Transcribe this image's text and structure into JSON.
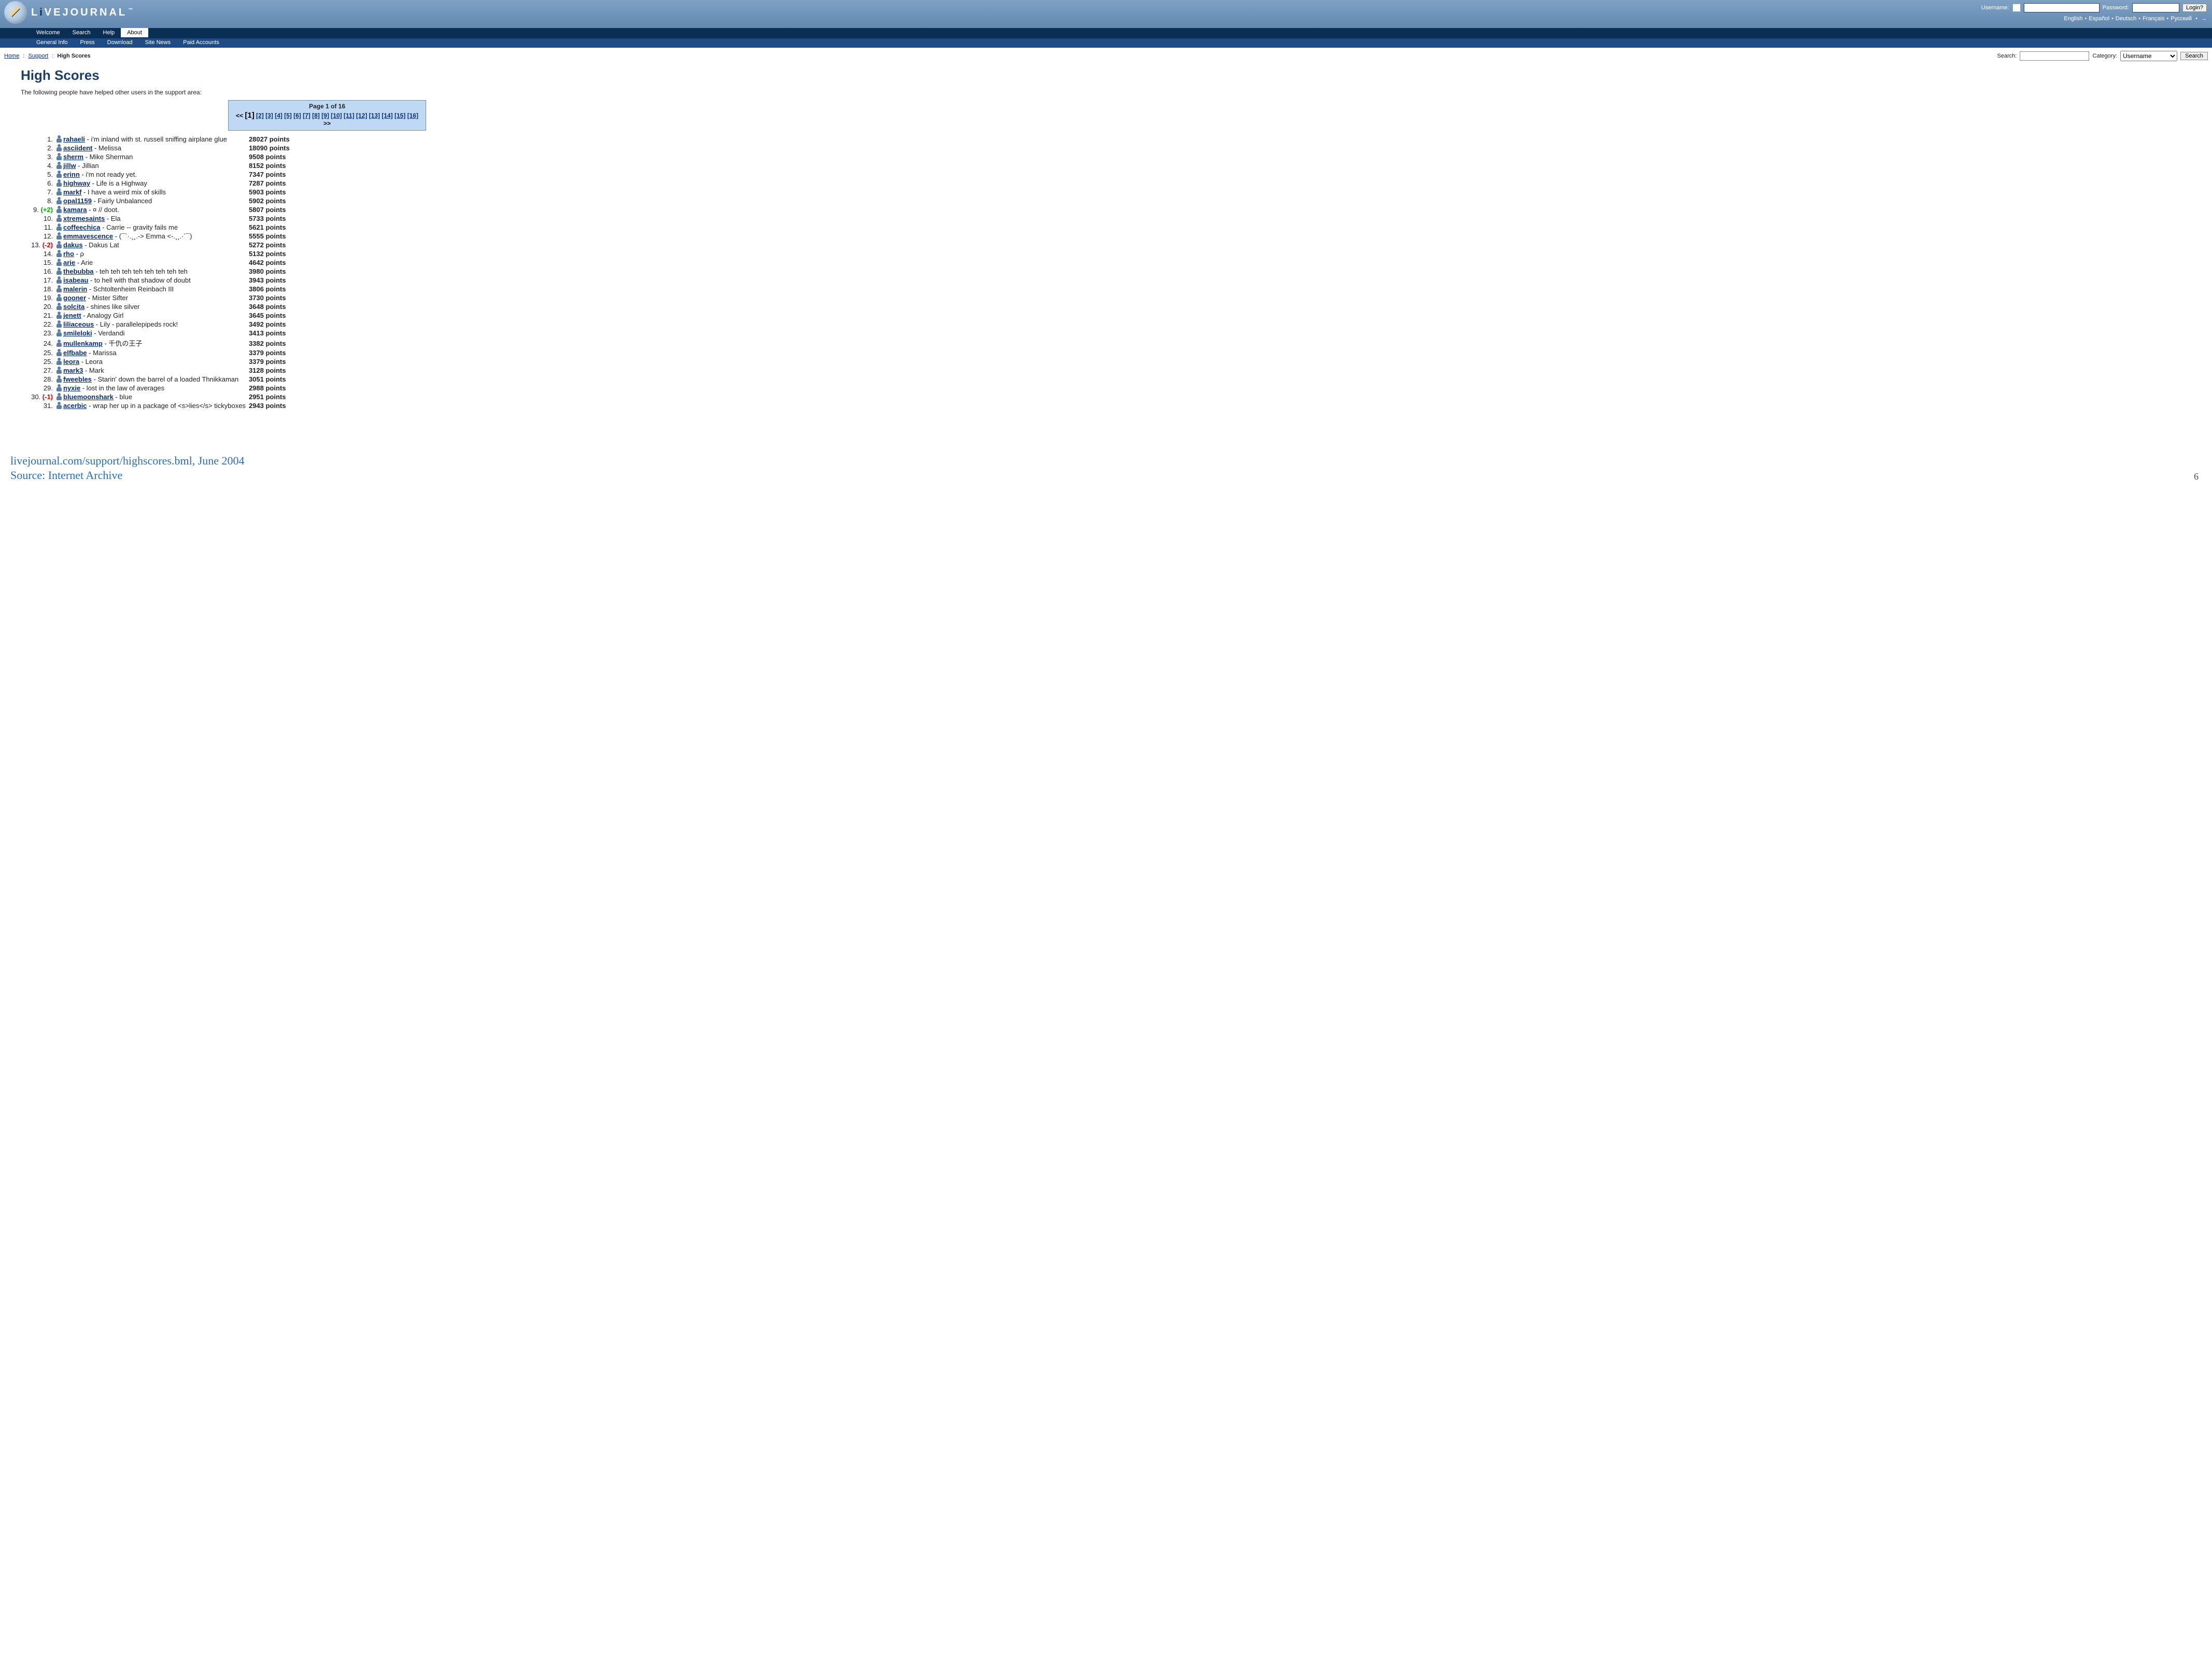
{
  "header": {
    "brand_left": "L",
    "brand_i": "i",
    "brand_rest": "VEJOURNAL",
    "tm": "™",
    "login": {
      "username_label": "Username:",
      "password_label": "Password:",
      "button": "Login?"
    },
    "languages": [
      "English",
      "Español",
      "Deutsch",
      "Français",
      "Русский"
    ],
    "lang_more": "→"
  },
  "nav1": {
    "items": [
      "Welcome",
      "Search",
      "Help",
      "About"
    ],
    "active_index": 3
  },
  "nav2": {
    "items": [
      "General Info",
      "Press",
      "Download",
      "Site News",
      "Paid Accounts"
    ]
  },
  "breadcrumb": {
    "home": "Home",
    "support": "Support",
    "current": "High Scores"
  },
  "search": {
    "label": "Search:",
    "category_label": "Category:",
    "category_value": "Username",
    "button": "Search"
  },
  "page_title": "High Scores",
  "intro": "The following people have helped other users in the support area:",
  "paginator": {
    "page_label": "Page 1 of 16",
    "prev": "<<",
    "next": ">>",
    "current": 1,
    "total": 16
  },
  "rows": [
    {
      "rank": "1.",
      "delta": "",
      "user": "rahaeli",
      "tag": "i'm inland with st. russell sniffing airplane glue",
      "points": "28027 points"
    },
    {
      "rank": "2.",
      "delta": "",
      "user": "asciident",
      "tag": "Melissa",
      "points": "18090 points"
    },
    {
      "rank": "3.",
      "delta": "",
      "user": "sherm",
      "tag": "Mike Sherman",
      "points": "9508 points"
    },
    {
      "rank": "4.",
      "delta": "",
      "user": "jillw",
      "tag": "Jillian",
      "points": "8152 points"
    },
    {
      "rank": "5.",
      "delta": "",
      "user": "erinn",
      "tag": "i'm not ready yet.",
      "points": "7347 points"
    },
    {
      "rank": "6.",
      "delta": "",
      "user": "highway",
      "tag": "Life is a Highway",
      "points": "7287 points"
    },
    {
      "rank": "7.",
      "delta": "",
      "user": "markf",
      "tag": "I have a weird mix of skills",
      "points": "5903 points"
    },
    {
      "rank": "8.",
      "delta": "",
      "user": "opal1159",
      "tag": "Fairly Unbalanced",
      "points": "5902 points"
    },
    {
      "rank": "9.",
      "delta": "(+2)",
      "delta_dir": "up",
      "user": "kamara",
      "tag": "¤ // doot.",
      "points": "5807 points"
    },
    {
      "rank": "10.",
      "delta": "",
      "user": "xtremesaints",
      "tag": "Ela",
      "points": "5733 points"
    },
    {
      "rank": "11.",
      "delta": "",
      "user": "coffeechica",
      "tag": "Carrie -- gravity fails me",
      "points": "5621 points"
    },
    {
      "rank": "12.",
      "delta": "",
      "user": "emmavescence",
      "tag": "(¯`·.¸¸.-> Emma <-.¸¸.·´¯)",
      "points": "5555 points"
    },
    {
      "rank": "13.",
      "delta": "(-2)",
      "delta_dir": "down",
      "user": "dakus",
      "tag": "Dakus Lat",
      "points": "5272 points"
    },
    {
      "rank": "14.",
      "delta": "",
      "user": "rho",
      "tag": "ρ",
      "points": "5132 points"
    },
    {
      "rank": "15.",
      "delta": "",
      "user": "arie",
      "tag": "Arie",
      "points": "4642 points"
    },
    {
      "rank": "16.",
      "delta": "",
      "user": "thebubba",
      "tag": "teh teh teh teh teh teh teh teh",
      "points": "3980 points"
    },
    {
      "rank": "17.",
      "delta": "",
      "user": "isabeau",
      "tag": "to hell with that shadow of doubt",
      "points": "3943 points"
    },
    {
      "rank": "18.",
      "delta": "",
      "user": "malerin",
      "tag": "Schtoltenheim Reinbach III",
      "points": "3806 points"
    },
    {
      "rank": "19.",
      "delta": "",
      "user": "gooner",
      "tag": "Mister Sifter",
      "points": "3730 points"
    },
    {
      "rank": "20.",
      "delta": "",
      "user": "solcita",
      "tag": "shines like silver",
      "points": "3648 points"
    },
    {
      "rank": "21.",
      "delta": "",
      "user": "jenett",
      "tag": "Analogy Girl",
      "points": "3645 points"
    },
    {
      "rank": "22.",
      "delta": "",
      "user": "liliaceous",
      "tag": "Lily - parallelepipeds rock!",
      "points": "3492 points"
    },
    {
      "rank": "23.",
      "delta": "",
      "user": "smileloki",
      "tag": "Verdandi",
      "points": "3413 points"
    },
    {
      "rank": "24.",
      "delta": "",
      "user": "mullenkamp",
      "tag": "千仇の王子",
      "points": "3382 points"
    },
    {
      "rank": "25.",
      "delta": "",
      "user": "elfbabe",
      "tag": "Marissa",
      "points": "3379 points"
    },
    {
      "rank": "25.",
      "delta": "",
      "user": "leora",
      "tag": "Leora",
      "points": "3379 points"
    },
    {
      "rank": "27.",
      "delta": "",
      "user": "mark3",
      "tag": "Mark",
      "points": "3128 points"
    },
    {
      "rank": "28.",
      "delta": "",
      "user": "fweebles",
      "tag": "Starin' down the barrel of a loaded Thnikkaman",
      "points": "3051 points"
    },
    {
      "rank": "29.",
      "delta": "",
      "user": "nyxie",
      "tag": "lost in the law of averages",
      "points": "2988 points"
    },
    {
      "rank": "30.",
      "delta": "(-1)",
      "delta_dir": "down",
      "user": "bluemoonshark",
      "tag": "blue",
      "points": "2951 points"
    },
    {
      "rank": "31.",
      "delta": "",
      "user": "acerbic",
      "tag": "wrap her up in a package of <s>lies</s> tickyboxes",
      "points": "2943 points"
    }
  ],
  "caption": {
    "line1": "livejournal.com/support/highscores.bml, June 2004",
    "line2": "Source: Internet Archive"
  },
  "page_number": "6"
}
